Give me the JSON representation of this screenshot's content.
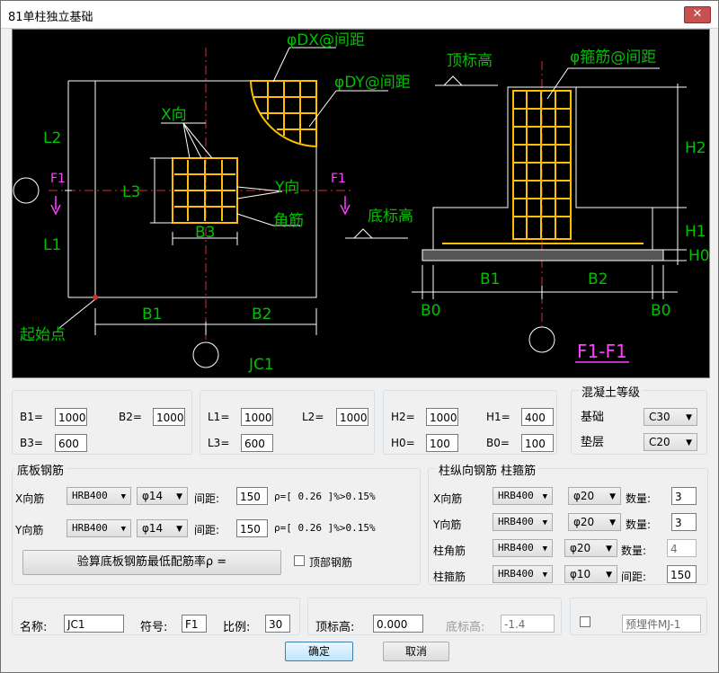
{
  "window": {
    "title": "81单柱独立基础",
    "close_glyph": "✕"
  },
  "drawing": {
    "plan": {
      "L2": "L2",
      "L1": "L1",
      "L3": "L3",
      "B3": "B3",
      "B1": "B1",
      "B2": "B2",
      "phi_dx": "φDX@间距",
      "phi_dy": "φDY@间距",
      "x_dir": "X向",
      "y_dir": "Y向",
      "corner": "角筋",
      "f1_left": "F1",
      "f1_right": "F1",
      "start_point": "起始点",
      "name": "JC1"
    },
    "section": {
      "top_elev": "顶标高",
      "stirrup": "φ箍筋@间距",
      "bottom_elev": "底标高",
      "H2": "H2",
      "H1": "H1",
      "H0": "H0",
      "B1": "B1",
      "B2": "B2",
      "B0_left": "B0",
      "B0_right": "B0",
      "name": "F1-F1"
    }
  },
  "dims": {
    "B1": {
      "label": "B1=",
      "value": "1000"
    },
    "B2": {
      "label": "B2=",
      "value": "1000"
    },
    "B3": {
      "label": "B3=",
      "value": "600"
    },
    "L1": {
      "label": "L1=",
      "value": "1000"
    },
    "L2": {
      "label": "L2=",
      "value": "1000"
    },
    "L3": {
      "label": "L3=",
      "value": "600"
    },
    "H2": {
      "label": "H2=",
      "value": "1000"
    },
    "H1": {
      "label": "H1=",
      "value": "400"
    },
    "H0": {
      "label": "H0=",
      "value": "100"
    },
    "B0": {
      "label": "B0=",
      "value": "100"
    }
  },
  "concrete": {
    "title": "混凝土等级",
    "base_label": "基础",
    "base_value": "C30",
    "pad_label": "垫层",
    "pad_value": "C20"
  },
  "slab_rebar": {
    "title": "底板钢筋",
    "x_label": "X向筋",
    "x_grade": "HRB400",
    "x_dia": "φ14",
    "x_spacing_label": "间距:",
    "x_spacing": "150",
    "x_ratio": "ρ=[  0.26 ]%>0.15%",
    "y_label": "Y向筋",
    "y_grade": "HRB400",
    "y_dia": "φ14",
    "y_spacing_label": "间距:",
    "y_spacing": "150",
    "y_ratio": "ρ=[  0.26 ]%>0.15%",
    "check_button": "验算底板钢筋最低配筋率ρ =",
    "top_rebar_label": "顶部钢筋"
  },
  "column_rebar": {
    "title": "柱纵向钢筋  柱箍筋",
    "x_label": "X向筋",
    "x_grade": "HRB400",
    "x_dia": "φ20",
    "x_count_label": "数量:",
    "x_count": "3",
    "y_label": "Y向筋",
    "y_grade": "HRB400",
    "y_dia": "φ20",
    "y_count_label": "数量:",
    "y_count": "3",
    "corner_label": "柱角筋",
    "corner_grade": "HRB400",
    "corner_dia": "φ20",
    "corner_count_label": "数量:",
    "corner_count": "4",
    "stirrup_label": "柱箍筋",
    "stirrup_grade": "HRB400",
    "stirrup_dia": "φ10",
    "stirrup_spacing_label": "间距:",
    "stirrup_spacing": "150"
  },
  "footer": {
    "name_label": "名称:",
    "name_value": "JC1",
    "symbol_label": "符号:",
    "symbol_value": "F1",
    "scale_label": "比例:",
    "scale_value": "30",
    "top_elev_label": "顶标高:",
    "top_elev_value": "0.000",
    "bottom_elev_label": "底标高:",
    "bottom_elev_value": "-1.4",
    "embed_placeholder": "预埋件MJ-1"
  },
  "buttons": {
    "ok": "确定",
    "cancel": "取消"
  },
  "colors": {
    "green": "#00c000",
    "red": "#d03030",
    "white": "#ffffff",
    "yellow": "#ffc000",
    "magenta": "#ff40ff",
    "canvas": "#000000"
  }
}
